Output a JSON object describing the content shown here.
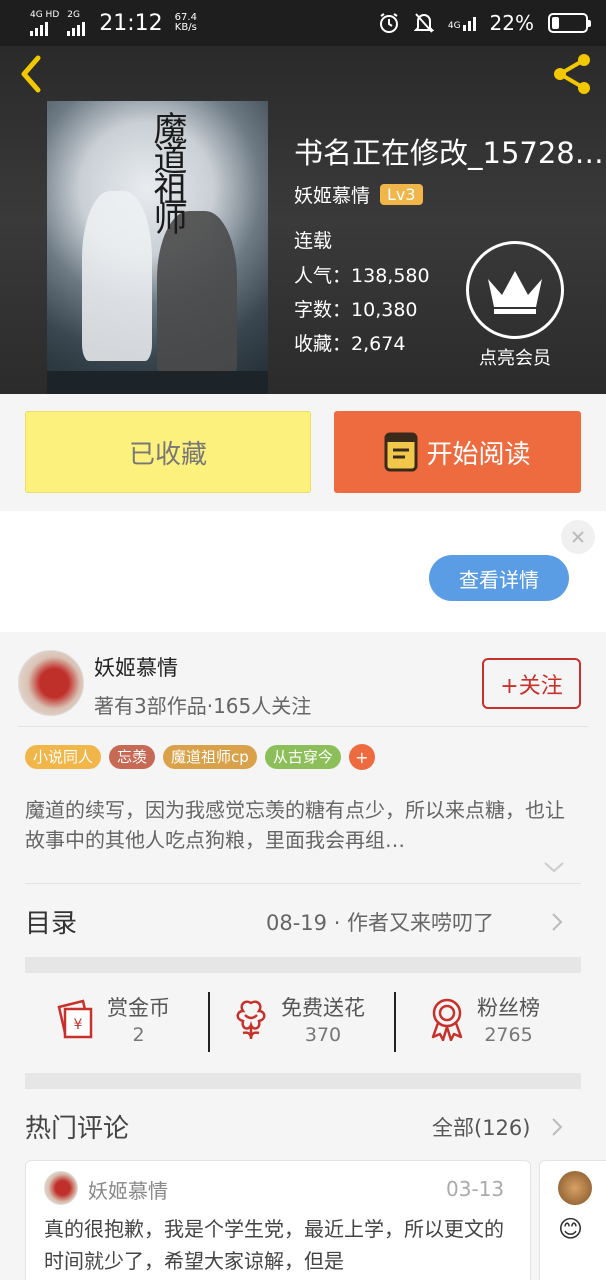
{
  "status_bar": {
    "net1": "4G HD",
    "net2": "2G",
    "time": "21:12",
    "speed_value": "67.4",
    "speed_unit": "KB/s",
    "net3": "4G",
    "battery": "22%",
    "battery_level": 0.22
  },
  "book": {
    "title": "书名正在修改_15728…",
    "cover_title": "魔道祖师",
    "author": "妖姬慕情",
    "level": "Lv3",
    "status": "连载",
    "popularity_label": "人气：",
    "popularity": "138,580",
    "wordcount_label": "字数：",
    "wordcount": "10,380",
    "favorites_label": "收藏：",
    "favorites": "2,674",
    "vip_label": "点亮会员"
  },
  "actions": {
    "collected": "已收藏",
    "start_reading": "开始阅读"
  },
  "ad": {
    "detail_button": "查看详情"
  },
  "author_card": {
    "name": "妖姬慕情",
    "meta": "著有3部作品·165人关注",
    "follow": "+关注"
  },
  "tags": [
    {
      "label": "小说同人",
      "color": "#f0b64a"
    },
    {
      "label": "忘羡",
      "color": "#c76a55"
    },
    {
      "label": "魔道祖师cp",
      "color": "#d9a24a"
    },
    {
      "label": "从古穿今",
      "color": "#8cbf5a"
    }
  ],
  "tag_more": "+",
  "description": "魔道的续写，因为我感觉忘羡的糖有点少，所以来点糖，也让故事中的其他人吃点狗粮，里面我会再组…",
  "toc": {
    "label": "目录",
    "latest": "08-19 · 作者又来唠叨了"
  },
  "stats": [
    {
      "label": "赏金币",
      "value": "2"
    },
    {
      "label": "免费送花",
      "value": "370"
    },
    {
      "label": "粉丝榜",
      "value": "2765"
    }
  ],
  "comments": {
    "label": "热门评论",
    "all": "全部(126)",
    "items": [
      {
        "user": "妖姬慕情",
        "date": "03-13",
        "text": "真的很抱歉，我是个学生党，最近上学，所以更文的时间就少了，希望大家谅解，但是"
      }
    ],
    "next_emoji": "😊"
  },
  "colors": {
    "accent_orange": "#ee6a3f",
    "collect_yellow": "#fdf17d",
    "follow_red": "#c7312b",
    "ad_blue": "#5b9de5",
    "icon_gold": "#f2c800"
  }
}
